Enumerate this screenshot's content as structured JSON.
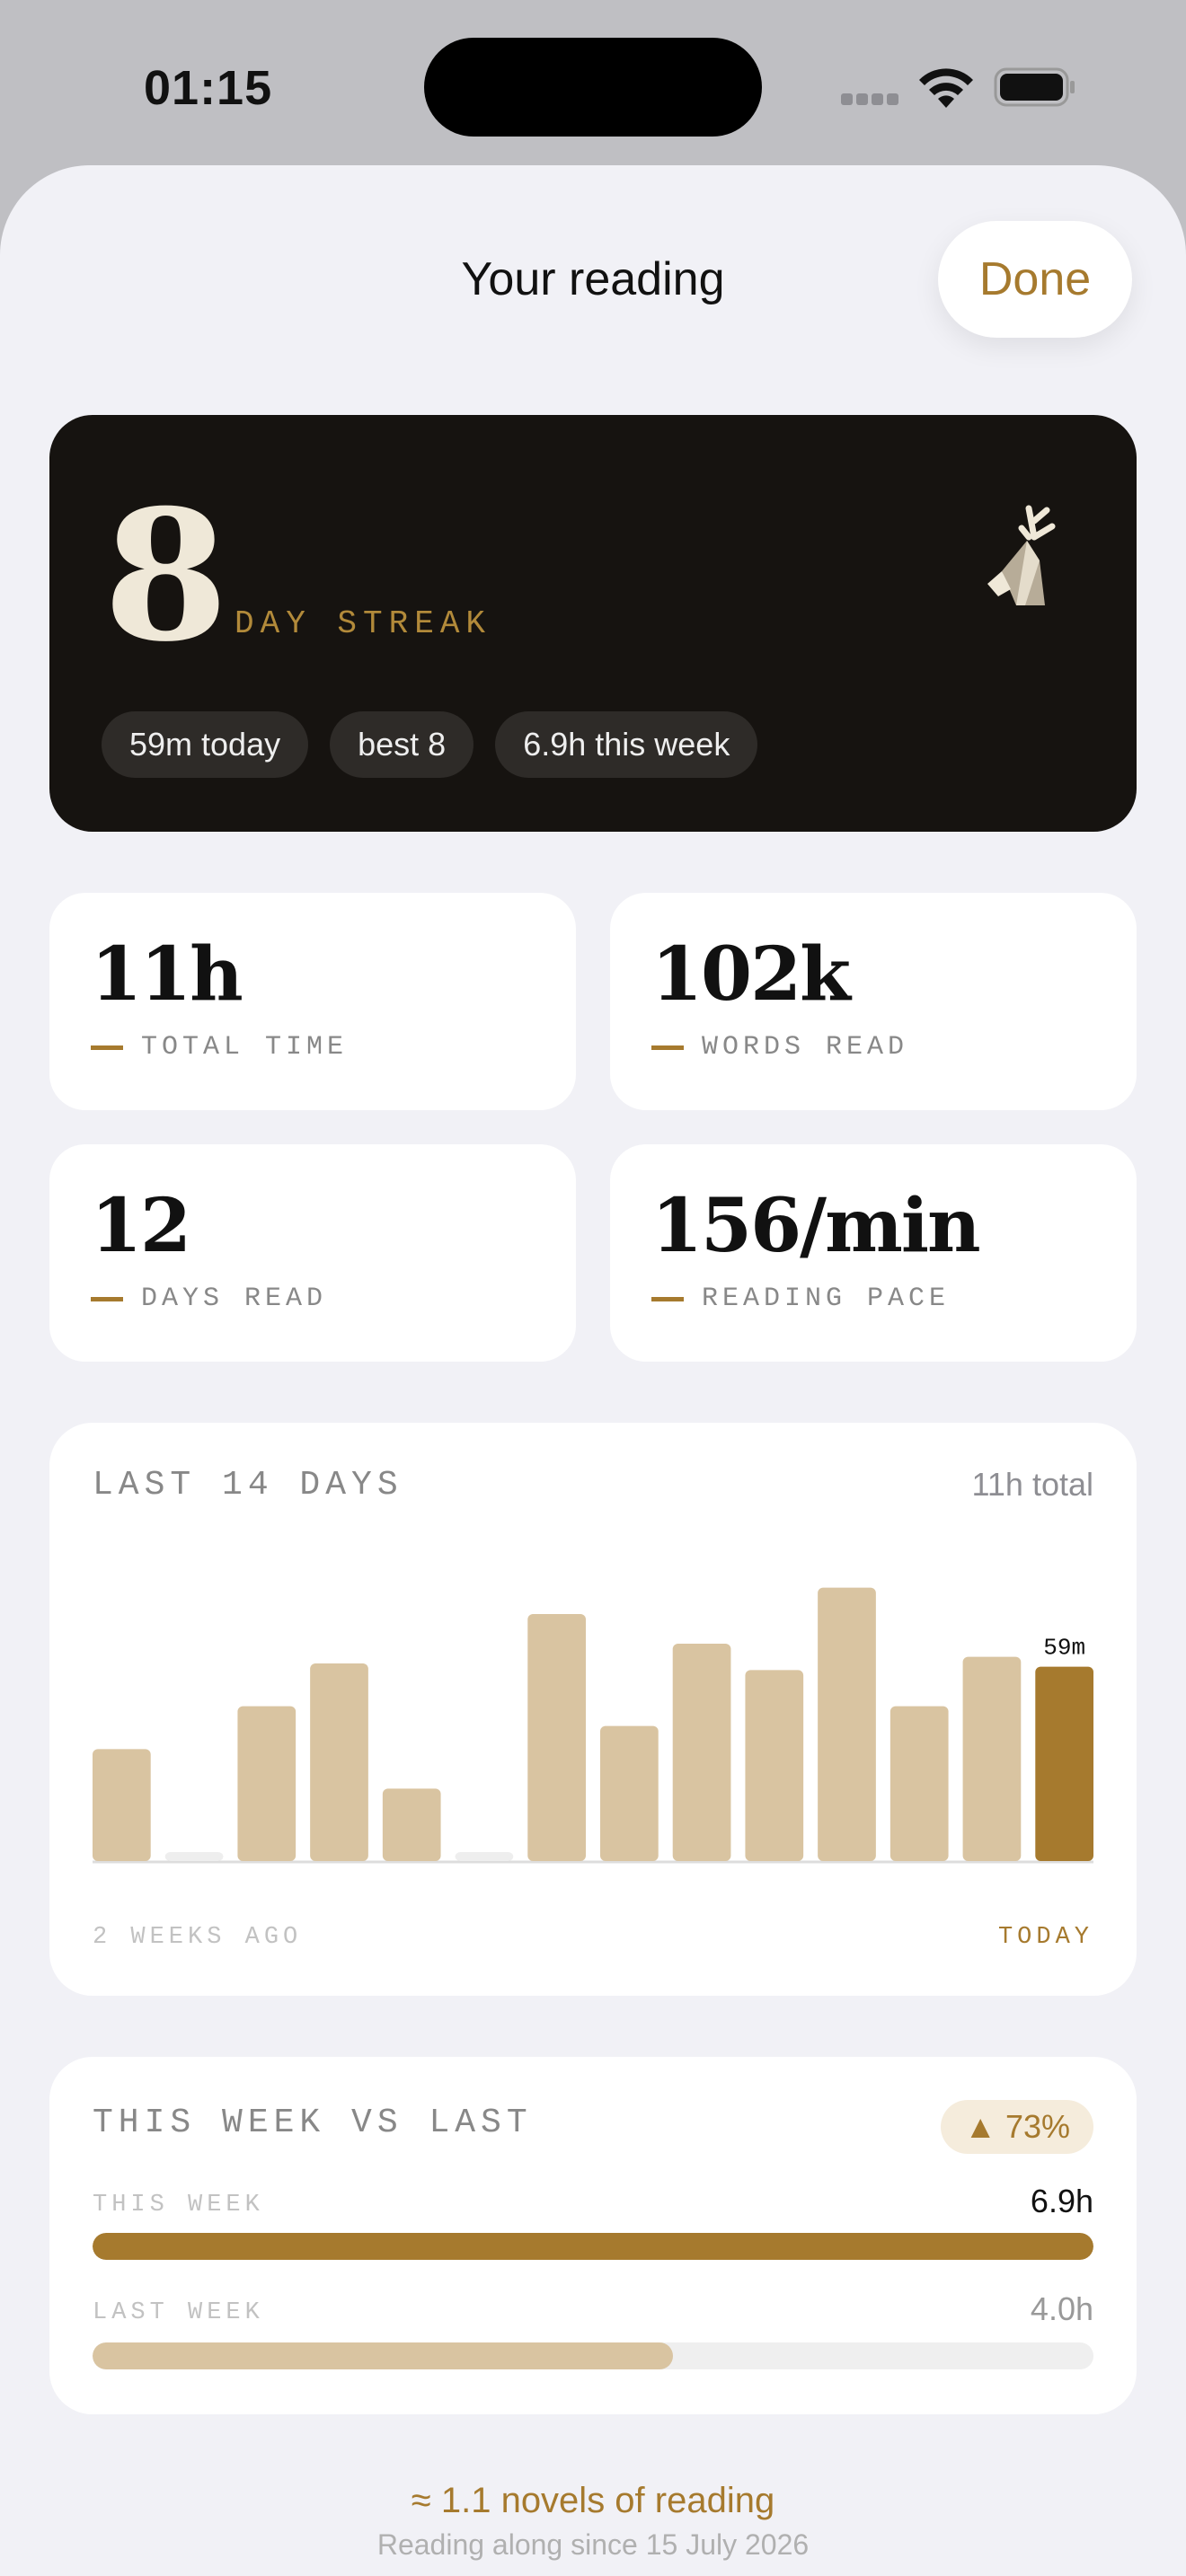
{
  "status_bar": {
    "time": "01:15"
  },
  "header": {
    "title": "Your reading",
    "done_label": "Done"
  },
  "streak": {
    "number": "8",
    "label": "DAY STREAK",
    "chips": [
      "59m today",
      "best 8",
      "6.9h this week"
    ]
  },
  "stats": [
    {
      "value": "11h",
      "label": "TOTAL TIME"
    },
    {
      "value": "102k",
      "label": "WORDS READ"
    },
    {
      "value": "12",
      "label": "DAYS READ"
    },
    {
      "value": "156/min",
      "label": "READING PACE"
    }
  ],
  "last14": {
    "heading": "LAST 14 DAYS",
    "total": "11h total",
    "start_label": "2 WEEKS AGO",
    "end_label": "TODAY"
  },
  "chart_data": {
    "type": "bar",
    "categories": [
      "d1",
      "d2",
      "d3",
      "d4",
      "d5",
      "d6",
      "d7",
      "d8",
      "d9",
      "d10",
      "d11",
      "d12",
      "d13",
      "d14"
    ],
    "values": [
      34,
      0,
      47,
      60,
      22,
      0,
      75,
      41,
      66,
      58,
      83,
      47,
      62,
      59
    ],
    "value_label_today": "59m",
    "ylim": [
      0,
      90
    ],
    "colors": {
      "bar": "#d9c4a1",
      "today": "#a67a2e",
      "empty": "#eeeeee",
      "baseline": "#dddddd"
    }
  },
  "compare": {
    "heading": "THIS WEEK VS LAST",
    "change": "▲ 73%",
    "this_week_label": "THIS WEEK",
    "this_week_value": "6.9h",
    "this_week_fraction": 1.0,
    "last_week_label": "LAST WEEK",
    "last_week_value": "4.0h",
    "last_week_fraction": 0.58
  },
  "footer": {
    "main": "≈ 1.1 novels of reading",
    "sub": "Reading along since 15 July 2026"
  }
}
